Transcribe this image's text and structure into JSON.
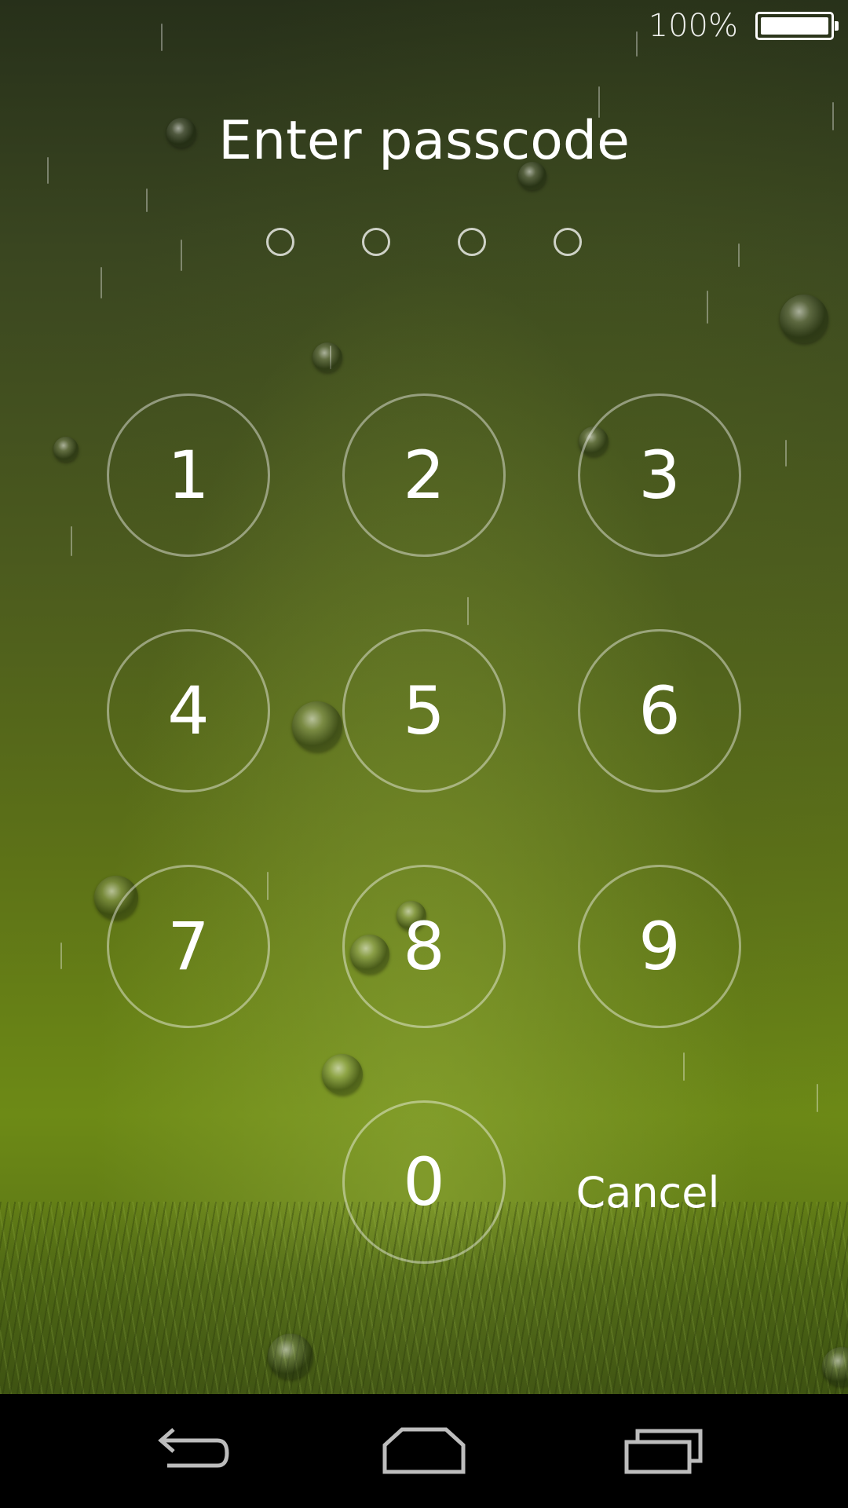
{
  "status_bar": {
    "battery_percent_label": "100%",
    "battery_level": 1.0
  },
  "lock_screen": {
    "title": "Enter passcode",
    "passcode_length": 4,
    "entered_digits": 0
  },
  "keypad": {
    "keys": [
      "1",
      "2",
      "3",
      "4",
      "5",
      "6",
      "7",
      "8",
      "9",
      "0"
    ],
    "cancel_label": "Cancel"
  },
  "nav_bar": {
    "buttons": [
      "back-icon",
      "home-icon",
      "recent-apps-icon"
    ]
  },
  "colors": {
    "text": "#ffffff",
    "key_border": "rgba(255,255,255,0.42)",
    "nav_background": "#000000",
    "wallpaper_tone": "#5d7217"
  }
}
